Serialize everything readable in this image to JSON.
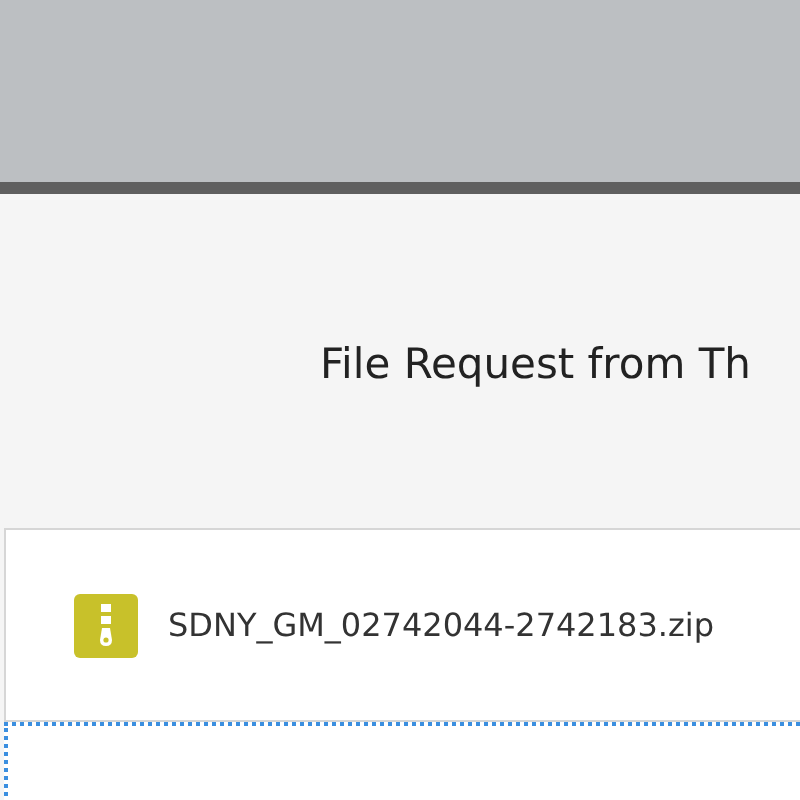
{
  "title": "File Request from Th",
  "files": [
    {
      "name": "SDNY_GM_02742044-2742183.zip",
      "kind": "zip"
    }
  ],
  "drop_zone": {
    "focused": true
  }
}
